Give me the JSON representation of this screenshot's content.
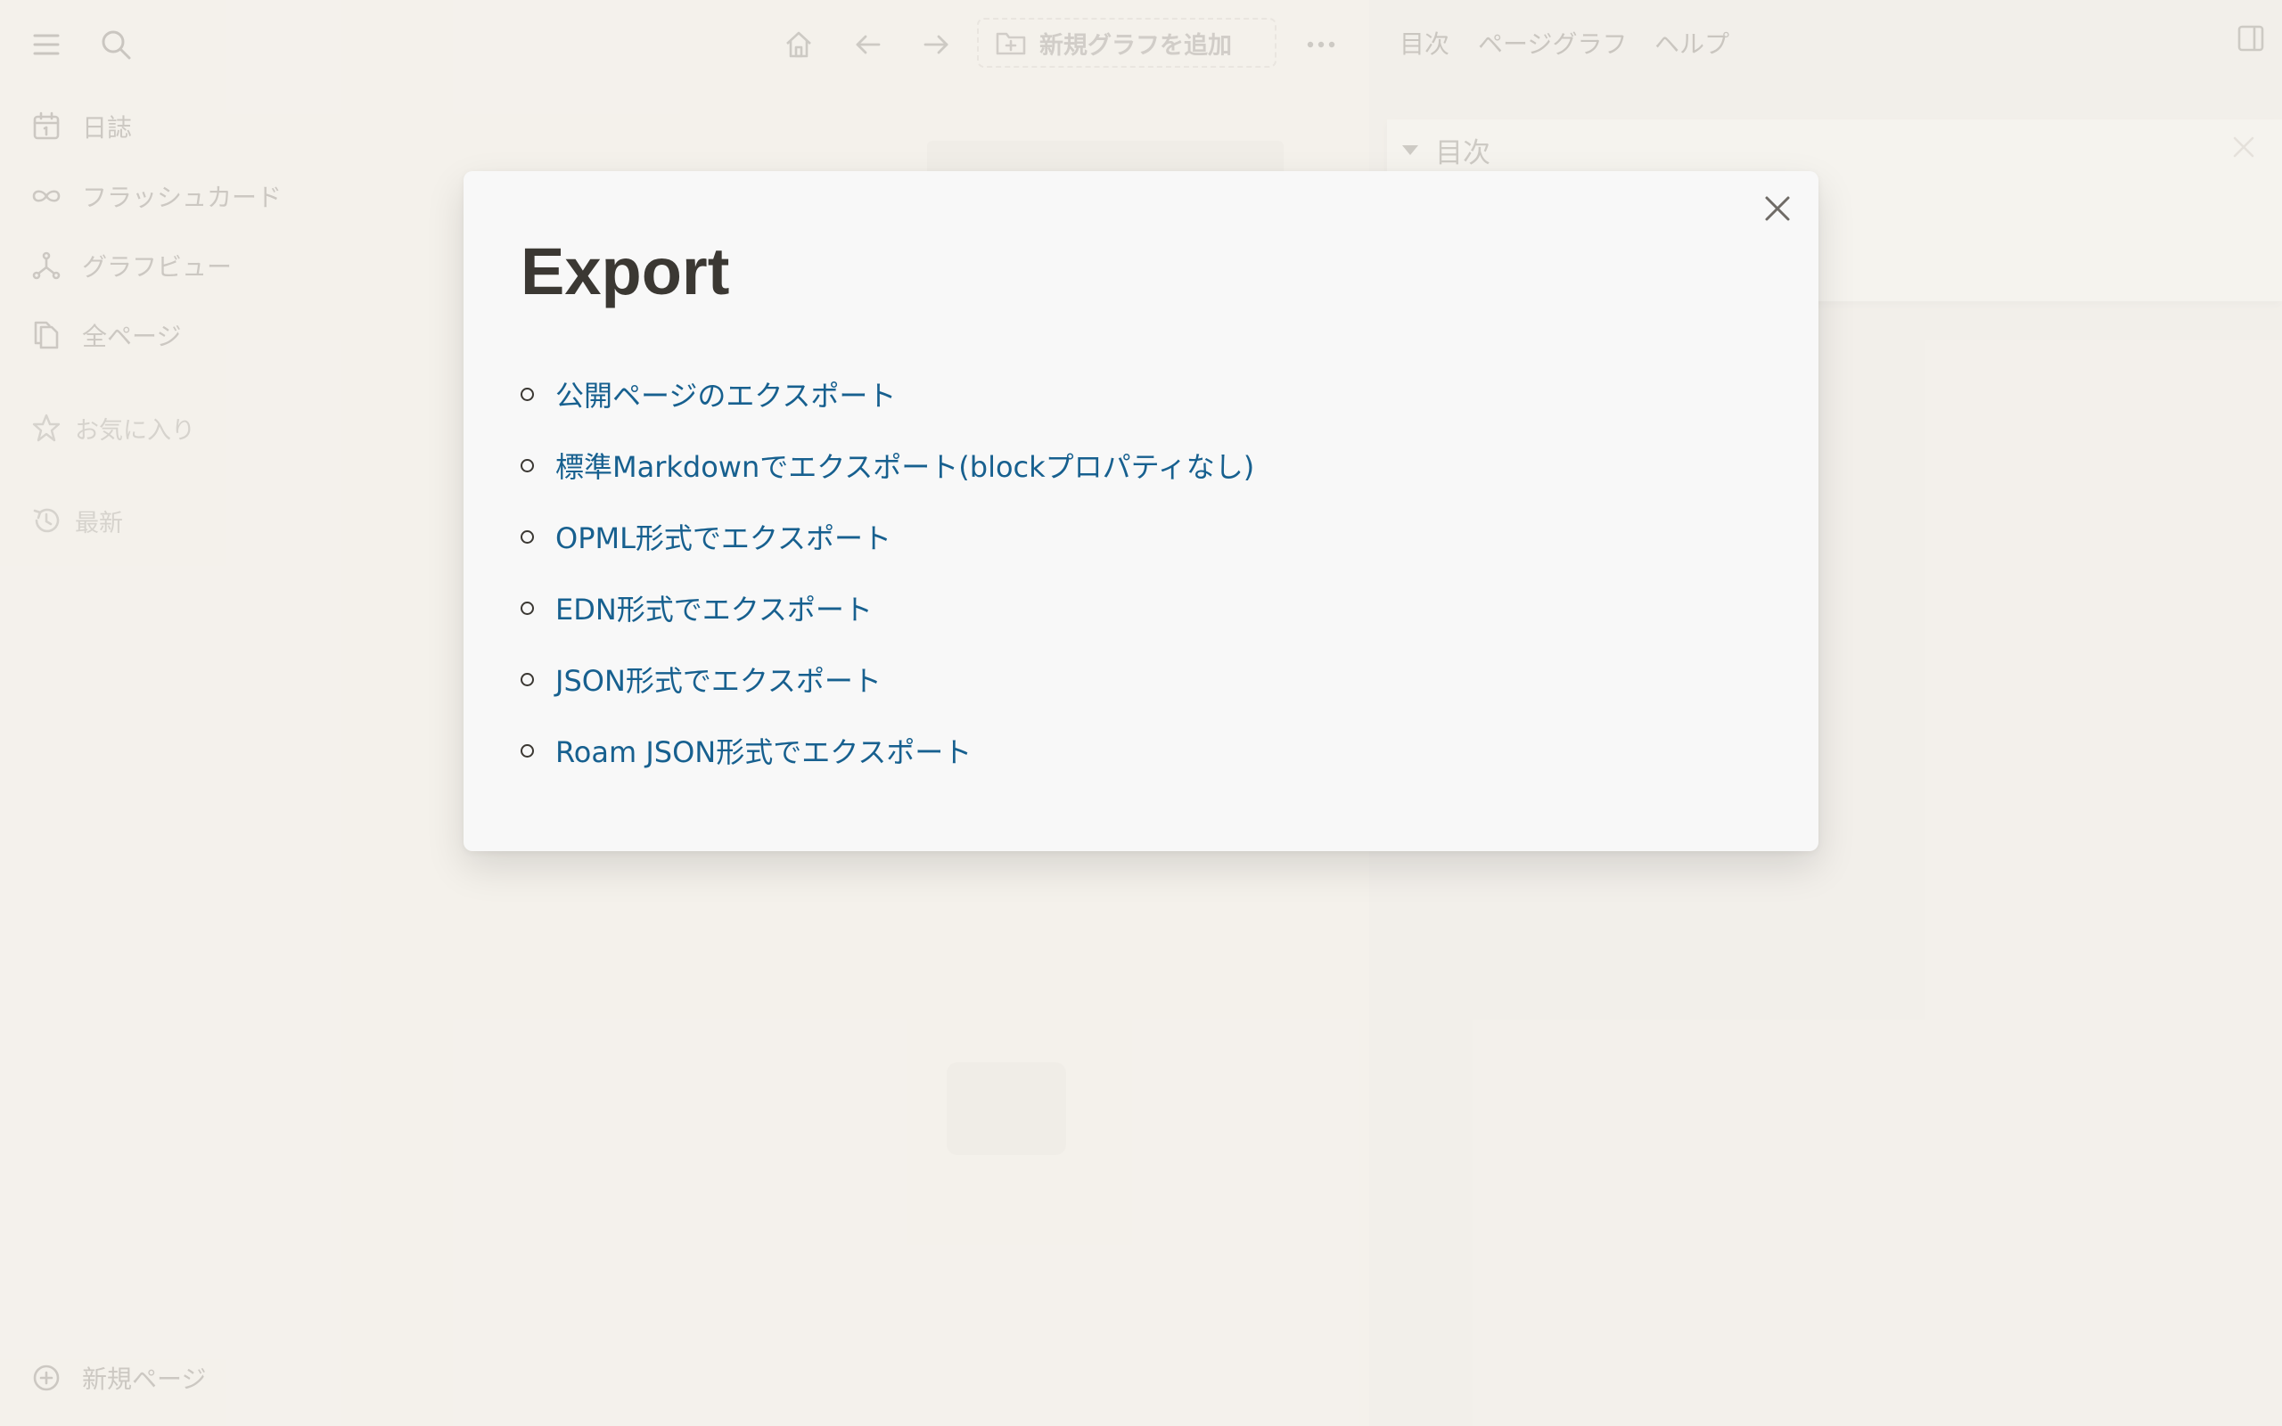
{
  "sidebar": {
    "items": [
      {
        "label": "日誌",
        "icon": "calendar-icon"
      },
      {
        "label": "フラッシュカード",
        "icon": "infinity-icon"
      },
      {
        "label": "グラフビュー",
        "icon": "graph-icon"
      },
      {
        "label": "全ページ",
        "icon": "pages-icon"
      }
    ],
    "favorites_label": "お気に入り",
    "recent_label": "最新",
    "new_page_label": "新規ページ"
  },
  "toolbar": {
    "add_graph_label": "新規グラフを追加"
  },
  "right_panel": {
    "tabs": [
      "目次",
      "ページグラフ",
      "ヘルプ"
    ],
    "toc_title": "目次"
  },
  "modal": {
    "title": "Export",
    "options": [
      "公開ページのエクスポート",
      "標準Markdownでエクスポート(blockプロパティなし)",
      "OPML形式でエクスポート",
      "EDN形式でエクスポート",
      "JSON形式でエクスポート",
      "Roam JSON形式でエクスポート"
    ]
  },
  "colors": {
    "background": "#f4f1ec",
    "modal_bg": "#f8f8f8",
    "link": "#17608f",
    "title": "#3b3833"
  }
}
